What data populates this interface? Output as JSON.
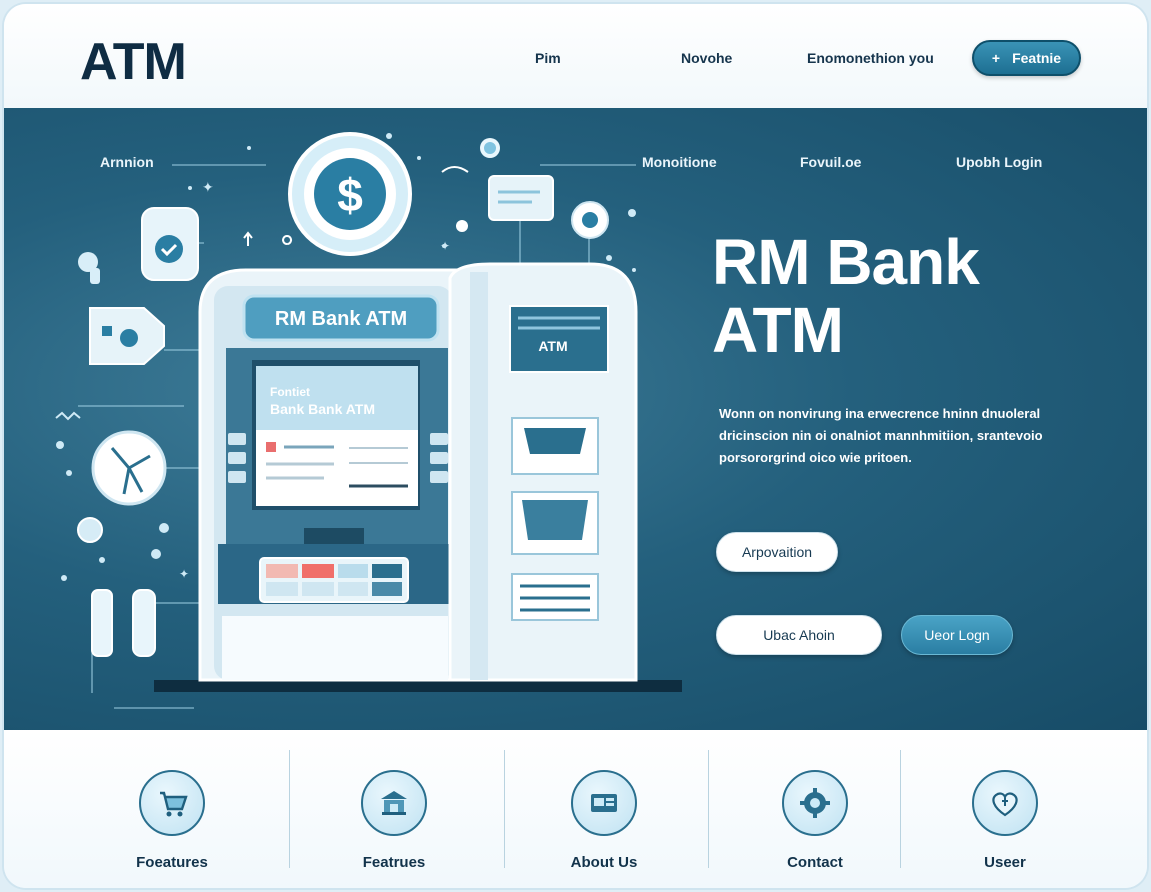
{
  "brand": {
    "logo": "ATM"
  },
  "nav": {
    "links": [
      "Pim",
      "Novohe",
      "Enomonethion you"
    ],
    "cta_label": "Featnie",
    "cta_icon": "plus-sparkle-icon"
  },
  "hero": {
    "side_labels": [
      "Arnnion",
      "Monoitione",
      "Fovuil.oe",
      "Upobh Login"
    ],
    "atm_sign": "RM Bank ATM",
    "screen_line1": "Fontiet",
    "screen_line2": "Bank Bank ATM",
    "atm_tower_label": "ATM",
    "title_line1": "RM Bank",
    "title_line2": "ATM",
    "description": "Wonn on nonvirung ina erwecrence hninn dnuoleral dricinscion nin oi onalniot mannhmitiion, srantevoio porsororgrind oico wie pritoen.",
    "button_primary": "Arpovaition",
    "button_secondary": "Ubac Ahoin",
    "button_login": "Ueor Logn",
    "colors": {
      "hero_bg": "#24607d",
      "accent": "#2a7ea3",
      "dark": "#0f2c43"
    }
  },
  "features": [
    {
      "label": "Foeatures",
      "icon": "cart-icon"
    },
    {
      "label": "Featrues",
      "icon": "bank-icon"
    },
    {
      "label": "About Us",
      "icon": "card-icon"
    },
    {
      "label": "Contact",
      "icon": "gear-icon"
    },
    {
      "label": "Useer",
      "icon": "heart-badge-icon"
    }
  ]
}
